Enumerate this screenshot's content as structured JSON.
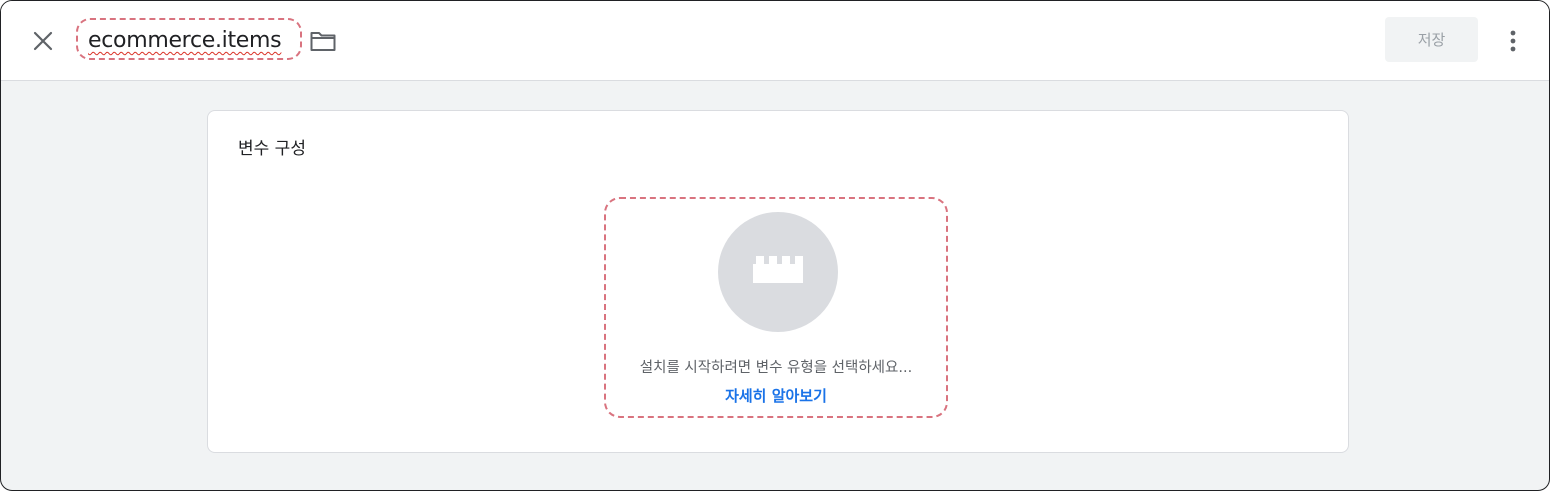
{
  "header": {
    "title": "ecommerce.items",
    "save_label": "저장",
    "icons": {
      "close": "close-icon",
      "folder": "folder-icon",
      "more": "more-vert-icon"
    }
  },
  "card": {
    "title": "변수 구성",
    "picker": {
      "icon": "brick-icon",
      "hint": "설치를 시작하려면 변수 유형을 선택하세요...",
      "learn_more": "자세히 알아보기"
    }
  },
  "colors": {
    "accent_link": "#1a73e8",
    "annotation_dash": "#d9737f",
    "disabled_text": "#9aa0a6"
  }
}
